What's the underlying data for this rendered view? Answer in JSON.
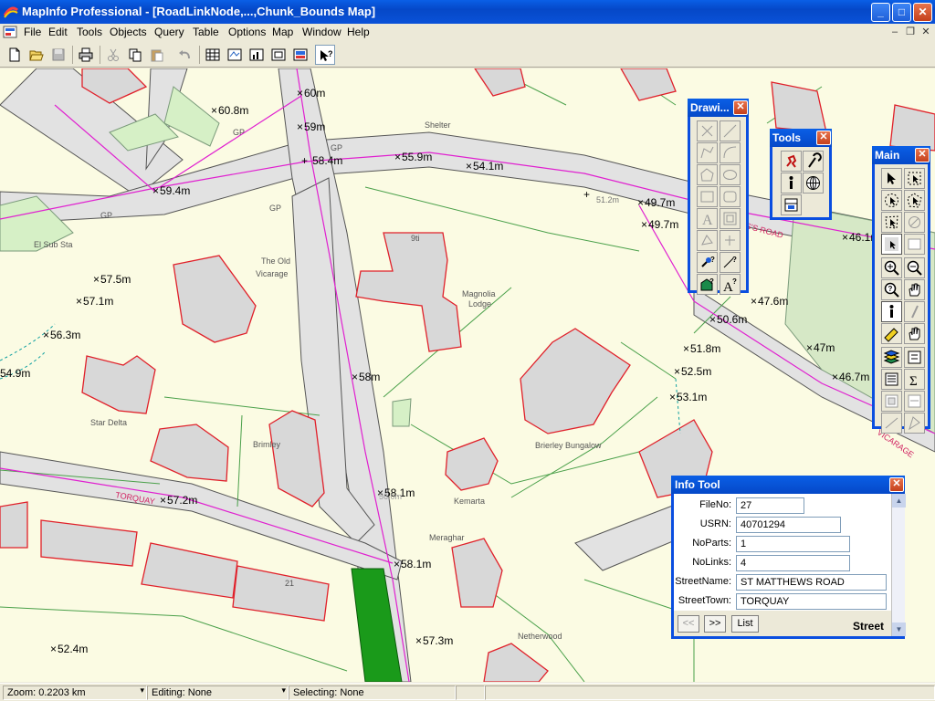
{
  "window": {
    "title": "MapInfo Professional - [RoadLinkNode,...,Chunk_Bounds Map]",
    "minimize": "_",
    "maximize": "□",
    "close": "✕"
  },
  "menubar": {
    "items": [
      "File",
      "Edit",
      "Tools",
      "Objects",
      "Query",
      "Table",
      "Options",
      "Map",
      "Window",
      "Help"
    ],
    "mdi_minimize": "–",
    "mdi_restore": "❐",
    "mdi_close": "✕"
  },
  "toolbar": {
    "tools": [
      "new-icon",
      "open-icon",
      "save-icon",
      "print-icon",
      "cut-icon",
      "copy-icon",
      "paste-icon",
      "undo-icon",
      "new-browser-icon",
      "new-mapper-icon",
      "new-grapher-icon",
      "new-layout-icon",
      "new-redistrict-icon",
      "help-pointer-icon"
    ]
  },
  "map": {
    "heights": [
      "60m",
      "60.8m",
      "59m",
      "58.4m",
      "55.9m",
      "54.1m",
      "59.4m",
      "51.2m",
      "49.7m",
      "49.7m",
      "46.1m",
      "57.5m",
      "57.1m",
      "56.3m",
      "54.9m",
      "58m",
      "47.6m",
      "50.6m",
      "51.8m",
      "47m",
      "52.5m",
      "46.7m",
      "53.1m",
      "58.1m",
      "57.2m",
      "58.1m",
      "57.3m",
      "52.4m"
    ],
    "labels": [
      "Shelter",
      "GP",
      "GP",
      "GP",
      "GP",
      "El Sub Sta",
      "The Old",
      "Vicarage",
      "Magnolia",
      "Lodge",
      "Star Delta",
      "Brimley",
      "Brierley Bungalow",
      "Kemarta",
      "Meraghar",
      "Netherwood",
      "9ti",
      "S'S ROAD",
      "VICARAGE",
      "TORQUAY",
      "56.0m",
      "21"
    ]
  },
  "drawing_palette": {
    "title": "Drawi...",
    "close": "✕"
  },
  "tools_palette": {
    "title": "Tools",
    "close": "✕"
  },
  "main_palette": {
    "title": "Main",
    "close": "✕"
  },
  "info_tool": {
    "title": "Info Tool",
    "close": "✕",
    "fields": [
      {
        "label": "FileNo:",
        "value": "27"
      },
      {
        "label": "USRN:",
        "value": "40701294"
      },
      {
        "label": "NoParts:",
        "value": "1"
      },
      {
        "label": "NoLinks:",
        "value": "4"
      },
      {
        "label": "StreetName:",
        "value": "ST MATTHEWS ROAD"
      },
      {
        "label": "StreetTown:",
        "value": "TORQUAY"
      }
    ],
    "prev_label": "<<",
    "next_label": ">>",
    "list_label": "List",
    "layer_name": "Street"
  },
  "statusbar": {
    "zoom": "Zoom: 0.2203 km",
    "editing": "Editing: None",
    "selecting": "Selecting: None"
  },
  "colors": {
    "title_blue": "#0a52d8",
    "map_background": "#fbfbe3",
    "road_fill": "#e4e4e4",
    "building_outline": "#e0202a",
    "road_centerline": "#e020d0",
    "vegetation_green": "#1a9a1a"
  }
}
